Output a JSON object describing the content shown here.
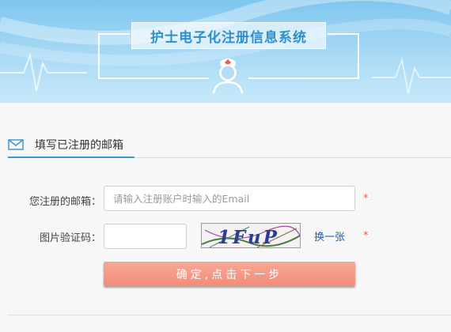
{
  "header": {
    "title": "护士电子化注册信息系统",
    "icon": "nurse-icon",
    "colors": {
      "banner_top": "#7fc6ee",
      "banner_bottom": "#c8e8fa",
      "title_text": "#2e8fcf"
    }
  },
  "section_tab": {
    "icon": "mail-icon",
    "label": "填写已注册的邮箱",
    "accent_color": "#3d97d4"
  },
  "form": {
    "email": {
      "label": "您注册的邮箱：",
      "value": "",
      "placeholder": "请输入注册账户时输入的Email",
      "required_mark": "*"
    },
    "captcha": {
      "label": "图片验证码：",
      "value": "",
      "placeholder": "",
      "image_text": "1FuP",
      "refresh_label": "换一张",
      "required_mark": "*"
    },
    "submit_label": "确定,点击下一步",
    "submit_color": "#f28c78",
    "required_color": "#e85a4f",
    "link_color": "#2b5c9a"
  }
}
